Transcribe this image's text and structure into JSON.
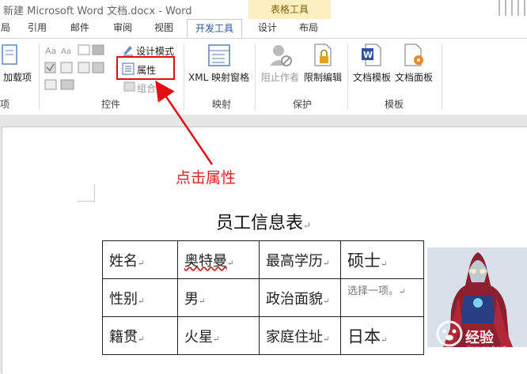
{
  "window": {
    "title": "新建 Microsoft Word 文档.docx - Word",
    "context_group": "表格工具"
  },
  "tabs": [
    {
      "label": "局"
    },
    {
      "label": "引用"
    },
    {
      "label": "邮件"
    },
    {
      "label": "审阅"
    },
    {
      "label": "视图"
    },
    {
      "label": "开发工具",
      "active": true
    },
    {
      "label": "设计"
    },
    {
      "label": "布局"
    }
  ],
  "ribbon": {
    "addins": {
      "label": "加载项"
    },
    "controls": {
      "group_label": "控件",
      "design_mode": "设计模式",
      "properties": "属性",
      "group": "组合"
    },
    "mapping": {
      "group_label": "映射",
      "xml_pane": "XML 映射窗格"
    },
    "protect": {
      "group_label": "保护",
      "block_authors": "阻止作者",
      "restrict_editing": "限制编辑"
    },
    "templates": {
      "group_label": "模板",
      "doc_template": "文档模板",
      "doc_panel": "文档面板"
    },
    "left_group_label": "项"
  },
  "annotation": {
    "text": "点击属性",
    "color": "#e02020"
  },
  "document": {
    "title": "员工信息表",
    "table": [
      [
        "姓名",
        "奥特曼",
        "最高学历",
        "硕士"
      ],
      [
        "性别",
        "男",
        "政治面貌",
        "选择一项。"
      ],
      [
        "籍贯",
        "火星",
        "家庭住址",
        "日本"
      ]
    ],
    "return_mark": "↵"
  },
  "watermark": {
    "text": "经验",
    "sub": "jingyan.baidu.com"
  },
  "colors": {
    "accent": "#2b579a",
    "highlight": "#e01010",
    "context_tab": "#fdf0c0"
  }
}
